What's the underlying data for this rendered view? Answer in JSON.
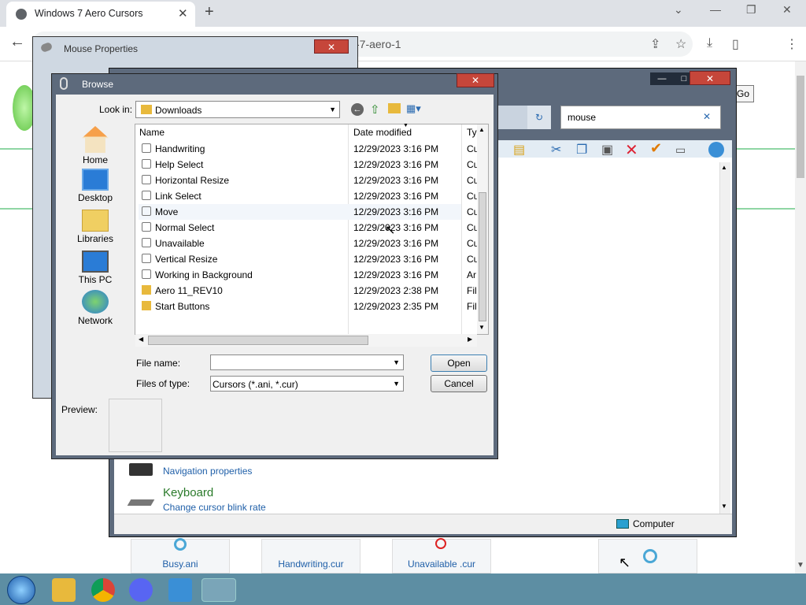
{
  "browser": {
    "tab_title": "Windows 7 Aero Cursors",
    "url_partial": "-7-aero-1"
  },
  "page": {
    "bottom_items": [
      "Busy.ani",
      "Handwriting.cur",
      "Unavailable .cur"
    ],
    "go_label": "Go"
  },
  "mouse_props": {
    "title": "Mouse Properties"
  },
  "control_panel": {
    "search_value": "mouse",
    "nav_link": "Navigation properties",
    "keyboard_title": "Keyboard",
    "keyboard_link": "Change cursor blink rate",
    "status": "Computer"
  },
  "browse": {
    "title": "Browse",
    "look_in_label": "Look in:",
    "look_in_value": "Downloads",
    "sidebar": [
      "Home",
      "Desktop",
      "Libraries",
      "This PC",
      "Network"
    ],
    "columns": {
      "name": "Name",
      "date": "Date modified",
      "type": "Ty"
    },
    "files": [
      {
        "name": "Handwriting",
        "date": "12/29/2023 3:16 PM",
        "type": "Cu"
      },
      {
        "name": "Help Select",
        "date": "12/29/2023 3:16 PM",
        "type": "Cu"
      },
      {
        "name": "Horizontal Resize",
        "date": "12/29/2023 3:16 PM",
        "type": "Cu"
      },
      {
        "name": "Link Select",
        "date": "12/29/2023 3:16 PM",
        "type": "Cu"
      },
      {
        "name": "Move",
        "date": "12/29/2023 3:16 PM",
        "type": "Cu"
      },
      {
        "name": "Normal Select",
        "date": "12/29/2023 3:16 PM",
        "type": "Cu"
      },
      {
        "name": "Unavailable",
        "date": "12/29/2023 3:16 PM",
        "type": "Cu"
      },
      {
        "name": "Vertical Resize",
        "date": "12/29/2023 3:16 PM",
        "type": "Cu"
      },
      {
        "name": "Working in Background",
        "date": "12/29/2023 3:16 PM",
        "type": "Ar"
      },
      {
        "name": "Aero 11_REV10",
        "date": "12/29/2023 2:38 PM",
        "type": "Fil"
      },
      {
        "name": "Start Buttons",
        "date": "12/29/2023 2:35 PM",
        "type": "Fil"
      }
    ],
    "file_name_label": "File name:",
    "file_name_value": "",
    "files_of_type_label": "Files of type:",
    "files_of_type_value": "Cursors (*.ani, *.cur)",
    "open_label": "Open",
    "cancel_label": "Cancel",
    "preview_label": "Preview:"
  },
  "colors": {
    "title_bar": "#5d6a7c",
    "close_red": "#c6463a",
    "taskbar": "#5d8ea3",
    "link_blue": "#1f5fa8",
    "green_text": "#2a7a2a"
  }
}
